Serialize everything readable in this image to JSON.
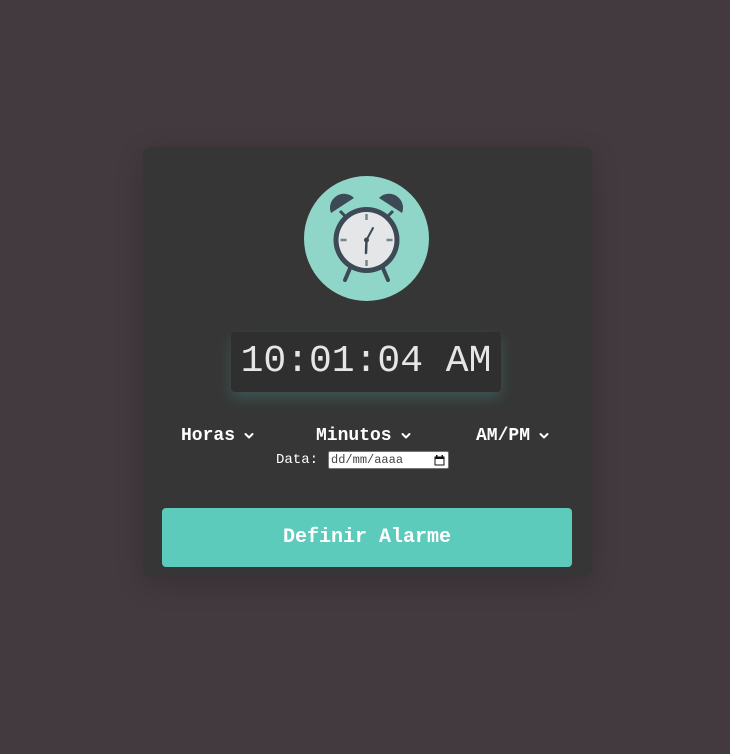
{
  "clock": {
    "time": "10:01:04 AM",
    "icon": "alarm-clock-icon"
  },
  "selects": {
    "hours": "Horas",
    "minutes": "Minutos",
    "ampm": "AM/PM"
  },
  "date": {
    "label": "Data:",
    "placeholder": "dd/mm/aaaa"
  },
  "button": {
    "label": "Definir Alarme"
  },
  "colors": {
    "background": "#433a3f",
    "card": "#363636",
    "accent": "#5ccbbc",
    "icon_circle": "#8fd6c9"
  }
}
